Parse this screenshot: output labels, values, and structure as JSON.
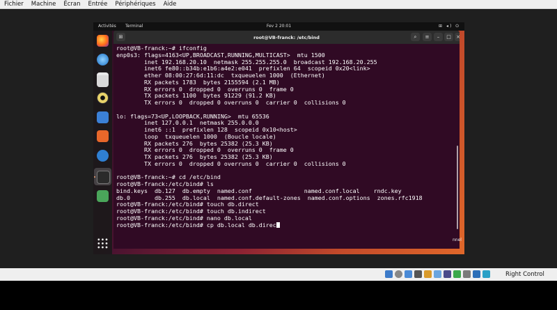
{
  "vbox_menu": [
    "Fichier",
    "Machine",
    "Écran",
    "Entrée",
    "Périphériques",
    "Aide"
  ],
  "topbar": {
    "activities": "Activités",
    "app": "Terminal",
    "clock": "Fev 2  20:01",
    "tray": "⊞ ◂) ⏻"
  },
  "terminal": {
    "title": "root@VB-franck: /etc/bind",
    "lines": [
      "root@VB-franck:~# ifconfig",
      "enp0s3: flags=4163<UP,BROADCAST,RUNNING,MULTICAST>  mtu 1500",
      "        inet 192.168.20.10  netmask 255.255.255.0  broadcast 192.168.20.255",
      "        inet6 fe80::b34b:e1b6:a4e2:e041  prefixlen 64  scopeid 0x20<link>",
      "        ether 08:00:27:6d:11:dc  txqueuelen 1000  (Ethernet)",
      "        RX packets 1783  bytes 2155594 (2.1 MB)",
      "        RX errors 0  dropped 0  overruns 0  frame 0",
      "        TX packets 1100  bytes 91229 (91.2 KB)",
      "        TX errors 0  dropped 0 overruns 0  carrier 0  collisions 0",
      "",
      "lo: flags=73<UP,LOOPBACK,RUNNING>  mtu 65536",
      "        inet 127.0.0.1  netmask 255.0.0.0",
      "        inet6 ::1  prefixlen 128  scopeid 0x10<host>",
      "        loop  txqueuelen 1000  (Boucle locale)",
      "        RX packets 276  bytes 25382 (25.3 KB)",
      "        RX errors 0  dropped 0  overruns 0  frame 0",
      "        TX packets 276  bytes 25382 (25.3 KB)",
      "        TX errors 0  dropped 0 overruns 0  carrier 0  collisions 0",
      "",
      "root@VB-franck:~# cd /etc/bind",
      "root@VB-franck:/etc/bind# ls",
      "bind.keys  db.127  db.empty  named.conf               named.conf.local    rndc.key",
      "db.0       db.255  db.local  named.conf.default-zones  named.conf.options  zones.rfc1918",
      "root@VB-franck:/etc/bind# touch db.direct",
      "root@VB-franck:/etc/bind# touch db.indirect",
      "root@VB-franck:/etc/bind# nano db.local",
      "root@VB-franck:/etc/bind# cp db.local db.direc"
    ]
  },
  "desktop_peek": "nnel",
  "statusbar": {
    "host_key": "Right Control"
  }
}
